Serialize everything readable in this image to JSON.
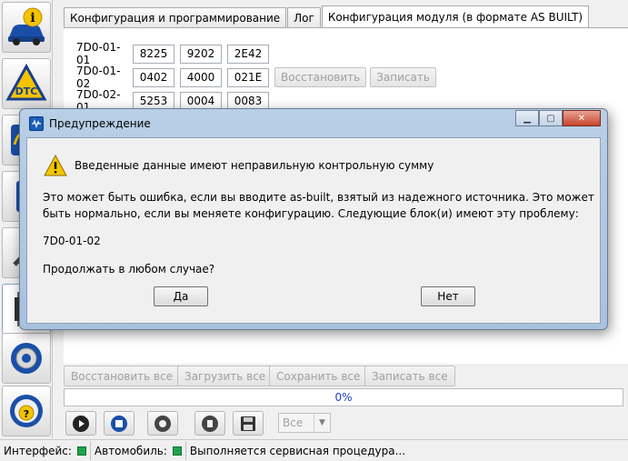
{
  "tabs": [
    {
      "label": "Конфигурация и программирование"
    },
    {
      "label": "Лог"
    },
    {
      "label": "Конфигурация модуля (в формате AS BUILT)"
    }
  ],
  "rail": {
    "items": [
      {
        "icon": "info-car-icon"
      },
      {
        "icon": "dtc-icon"
      },
      {
        "icon": "oscilloscope-icon"
      },
      {
        "icon": "diagnostic-tool-icon"
      },
      {
        "icon": "wrench-icon"
      },
      {
        "icon": "chip-config-icon"
      },
      {
        "icon": "gear-icon"
      },
      {
        "icon": "steering-help-icon"
      }
    ]
  },
  "blocks": [
    {
      "id": "7D0-01-01",
      "values": [
        "8225",
        "9202",
        "2E42"
      ]
    },
    {
      "id": "7D0-01-02",
      "values": [
        "0402",
        "4000",
        "021E"
      ],
      "restore_label": "Восстановить",
      "write_label": "Записать"
    },
    {
      "id": "7D0-02-01",
      "values": [
        "5253",
        "0004",
        "0083"
      ]
    }
  ],
  "actions": {
    "restore_all": "Восстановить все",
    "load_all": "Загрузить все",
    "save_all": "Сохранить все",
    "write_all": "Записать все"
  },
  "progress": {
    "text": "0%",
    "value": 0
  },
  "toolbar": {
    "play": "play-icon",
    "stop": "stop-icon",
    "help": "lifebuoy-icon",
    "clear": "trash-icon",
    "save": "floppy-icon",
    "filter_value": "Все"
  },
  "status": {
    "interface_label": "Интерфейс:",
    "vehicle_label": "Автомобиль:",
    "message": "Выполняется сервисная процедура..."
  },
  "dialog": {
    "title": "Предупреждение",
    "heading": "Введенные данные имеют неправильную контрольную сумму",
    "line1": "Это может быть ошибка, если вы вводите as-built, взятый из надежного источника. Это может",
    "line2": "быть нормально, если вы меняете конфигурацию. Следующие блок(и) имеют эту проблему:",
    "block": "7D0-01-02",
    "question": "Продолжать в любом случае?",
    "yes": "Да",
    "no": "Нет"
  },
  "colors": {
    "progress_text": "#1f3fbf",
    "status_led": "#1fa34a",
    "dialog_frame": "#b9cfe7",
    "warning": "#f5c400"
  }
}
